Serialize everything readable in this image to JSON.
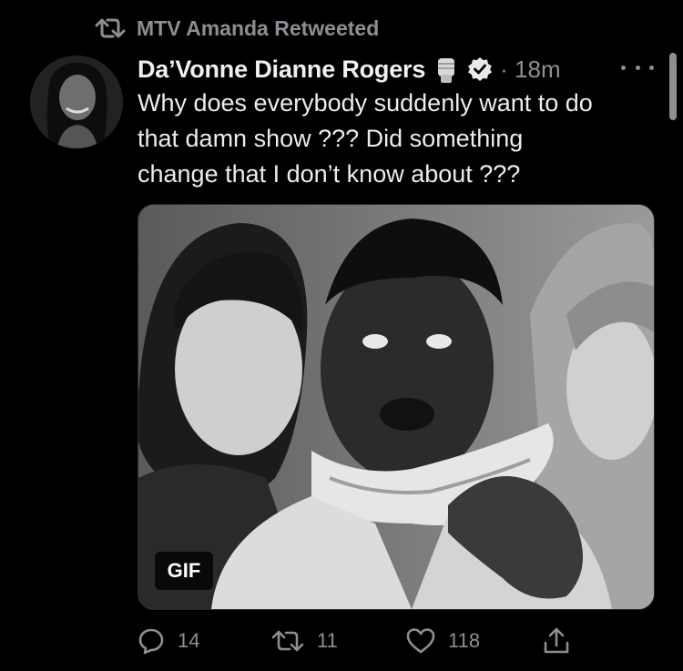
{
  "retweet": {
    "text": "MTV Amanda Retweeted",
    "icon": "retweet-icon"
  },
  "author": {
    "name": "Da’Vonne Dianne Rogers",
    "emoji": "raised-fist-emoji",
    "verified_icon": "verified-badge-icon",
    "time": "· 18m"
  },
  "tweet": {
    "lines": [
      "Why does everybody suddenly want to do",
      "that damn show ??? Did something",
      "change that I don’t know about ???"
    ]
  },
  "media": {
    "badge": "GIF"
  },
  "actions": {
    "reply_count": "14",
    "retweet_count": "11",
    "like_count": "118"
  },
  "colors": {
    "background": "#000000",
    "text": "#e7e9ea",
    "muted": "#8b8f94"
  }
}
